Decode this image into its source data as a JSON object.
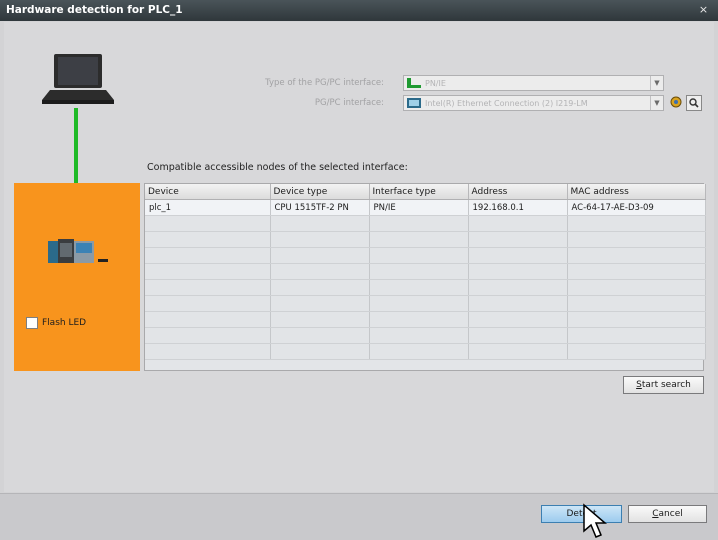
{
  "window": {
    "title": "Hardware detection for PLC_1",
    "close_glyph": "×"
  },
  "interface": {
    "type_label": "Type of the PG/PC interface:",
    "type_value": "PN/IE",
    "pgpc_label": "PG/PC interface:",
    "pgpc_value": "Intel(R) Ethernet Connection (2) I219-LM"
  },
  "nodes": {
    "caption": "Compatible accessible nodes of the selected interface:",
    "columns": [
      "Device",
      "Device type",
      "Interface type",
      "Address",
      "MAC address"
    ],
    "rows": [
      [
        "plc_1",
        "CPU 1515TF-2 PN",
        "PN/IE",
        "192.168.0.1",
        "AC-64-17-AE-D3-09"
      ]
    ]
  },
  "flash_led": {
    "label": "Flash LED",
    "checked": false
  },
  "buttons": {
    "start_search": "Start search",
    "detect": "Detect",
    "cancel": "Cancel"
  },
  "colors": {
    "accent_orange": "#f8941d",
    "connection_green": "#1fba26",
    "titlebar": "#2f373b"
  },
  "icons": {
    "pc": "laptop-icon",
    "plc": "plc-device-icon",
    "connection": "network-connection-line",
    "iface_type": "network-adapter-icon",
    "iface": "ethernet-card-icon",
    "properties": "properties-icon",
    "diagnostics": "search-magnifier-icon"
  }
}
